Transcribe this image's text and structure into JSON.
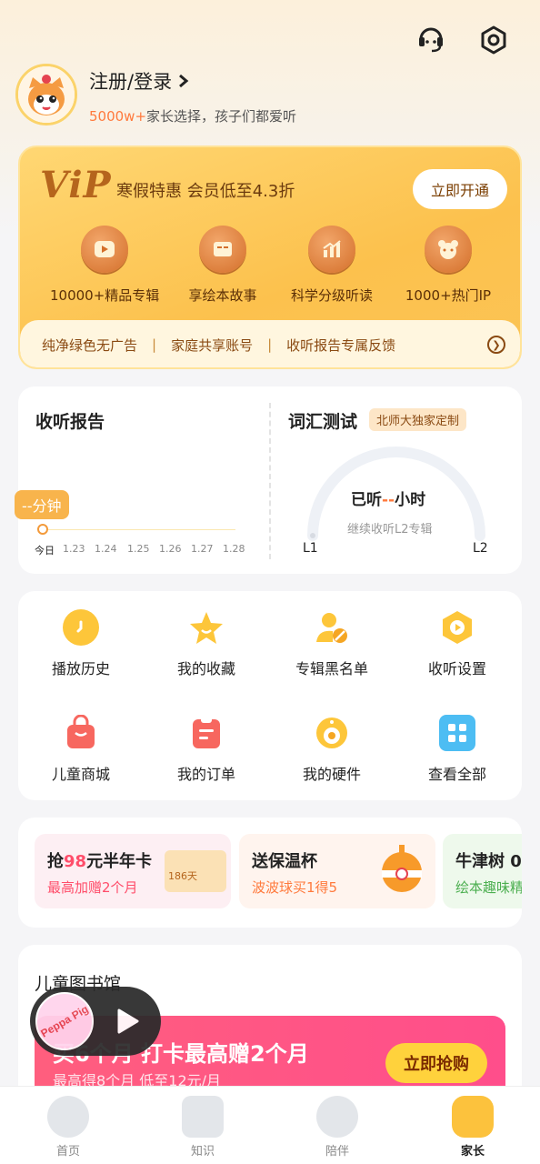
{
  "header": {
    "login_text": "注册/登录",
    "subtitle_highlight": "5000w+",
    "subtitle_rest": "家长选择，孩子们都爱听"
  },
  "vip": {
    "logo": "ViP",
    "title": "寒假特惠  会员低至4.3折",
    "open_button": "立即开通",
    "features": [
      {
        "label": "10000+精品专辑",
        "icon": "play-icon"
      },
      {
        "label": "享绘本故事",
        "icon": "book-icon"
      },
      {
        "label": "科学分级听读",
        "icon": "chart-icon"
      },
      {
        "label": "1000+热门IP",
        "icon": "bear-icon"
      }
    ],
    "benefits": [
      "纯净绿色无广告",
      "家庭共享账号",
      "收听报告专属反馈"
    ]
  },
  "report": {
    "title": "收听报告",
    "bubble": "--分钟",
    "dates": [
      "今日",
      "1.23",
      "1.24",
      "1.25",
      "1.26",
      "1.27",
      "1.28"
    ]
  },
  "vocab": {
    "title": "词汇测试",
    "tag": "北师大独家定制",
    "listened_prefix": "已听",
    "listened_value": "--",
    "listened_suffix": "小时",
    "continue_text": "继续收听L2专辑",
    "left_level": "L1",
    "right_level": "L2"
  },
  "grid": {
    "row1": [
      {
        "label": "播放历史",
        "icon": "clock-icon"
      },
      {
        "label": "我的收藏",
        "icon": "star-icon"
      },
      {
        "label": "专辑黑名单",
        "icon": "user-block-icon"
      },
      {
        "label": "收听设置",
        "icon": "settings-play-icon"
      }
    ],
    "row2": [
      {
        "label": "儿童商城",
        "icon": "shopping-bag-icon"
      },
      {
        "label": "我的订单",
        "icon": "clipboard-icon"
      },
      {
        "label": "我的硬件",
        "icon": "device-icon"
      },
      {
        "label": "查看全部",
        "icon": "apps-icon"
      }
    ]
  },
  "promos": [
    {
      "title_a": "抢",
      "title_b": "98",
      "title_c": "元半年卡",
      "sub": "最高加赠2个月",
      "badge": "186天"
    },
    {
      "title": "送保温杯",
      "sub": "波波球买1得5"
    },
    {
      "title": "牛津树 0",
      "sub": "绘本趣味精"
    }
  ],
  "library": {
    "title": "儿童图书馆",
    "banner_title": "买6个月 打卡最高赠2个月",
    "banner_sub": "最高得8个月 低至12元/月",
    "buy_button": "立即抢购",
    "player_badge": "Peppa Pig"
  },
  "tabs": [
    {
      "label": "首页"
    },
    {
      "label": "知识"
    },
    {
      "label": "陪伴"
    },
    {
      "label": "家长"
    }
  ],
  "colors": {
    "accent": "#fbc14d",
    "highlight": "#ff7a3d",
    "brown": "#8a4a12"
  }
}
